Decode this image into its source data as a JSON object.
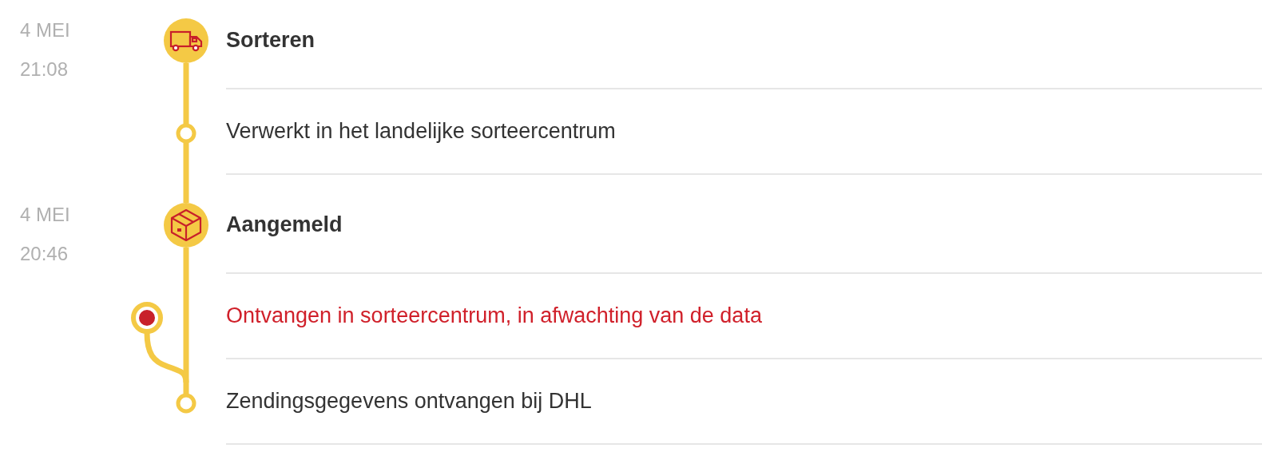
{
  "groups": [
    {
      "date": "4 MEI",
      "time": "21:08",
      "title": "Sorteren",
      "steps": [
        {
          "kind": "step",
          "text": "Verwerkt in het landelijke sorteercentrum"
        }
      ]
    },
    {
      "date": "4 MEI",
      "time": "20:46",
      "title": "Aangemeld",
      "steps": [
        {
          "kind": "alert",
          "text": "Ontvangen in sorteercentrum, in afwachting van de data"
        },
        {
          "kind": "step",
          "text": "Zendingsgegevens ontvangen bij DHL"
        }
      ]
    }
  ]
}
